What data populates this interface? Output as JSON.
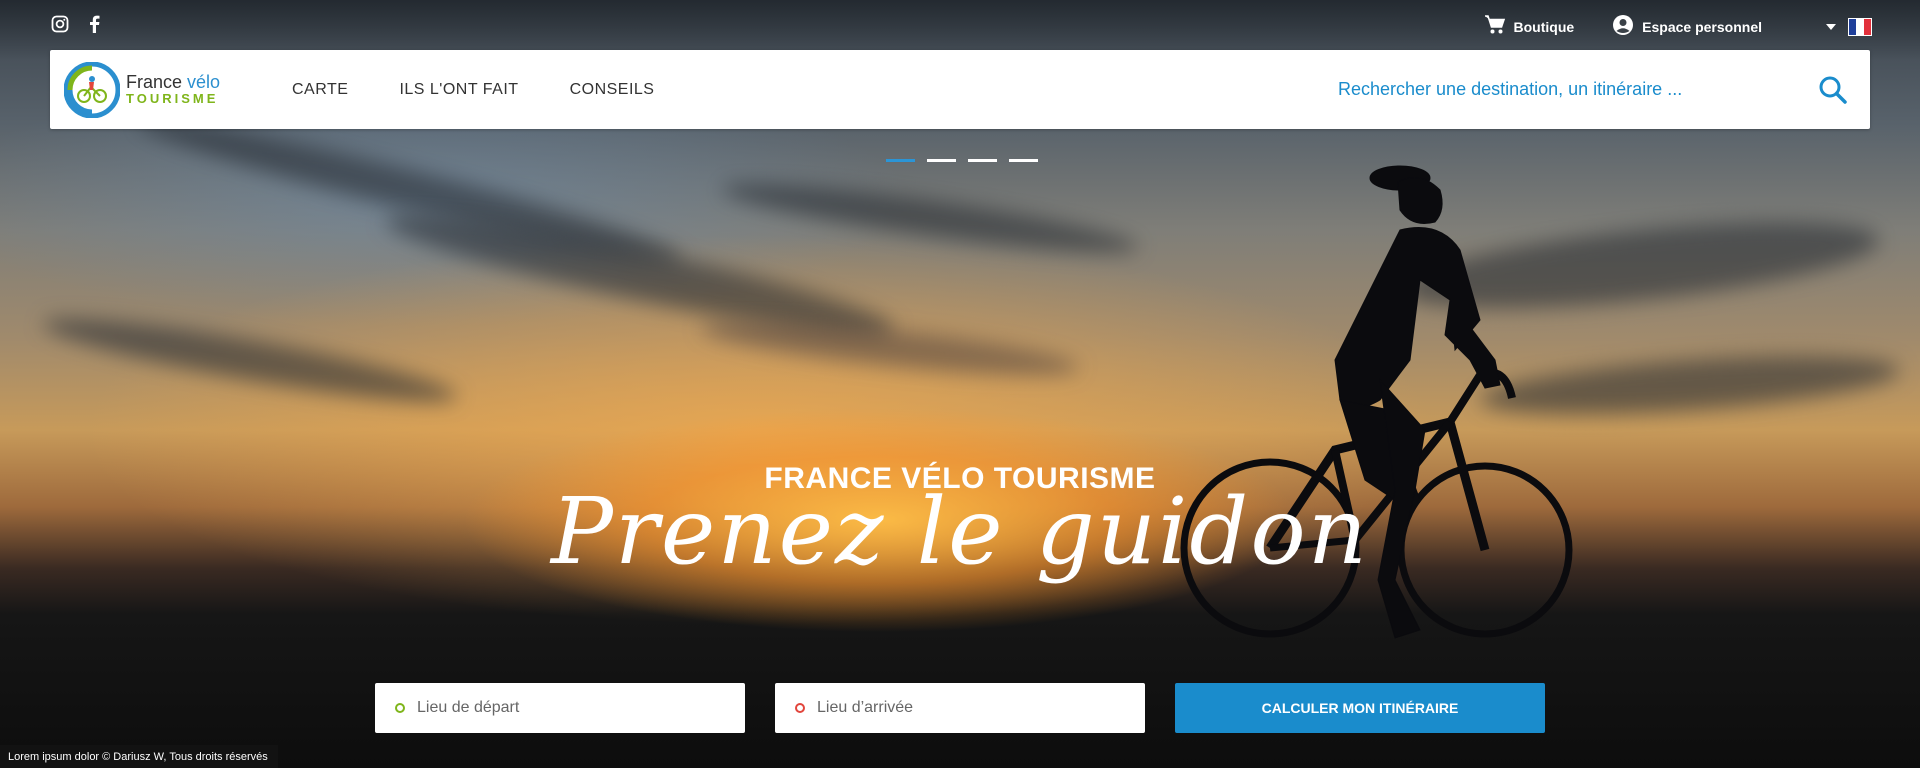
{
  "social": {
    "icons": [
      "instagram-icon",
      "facebook-icon"
    ]
  },
  "utility": {
    "shop_label": "Boutique",
    "account_label": "Espace personnel",
    "language": "fr"
  },
  "brand": {
    "line1_a": "France",
    "line1_b": "vélo",
    "line2": "TOURISME"
  },
  "nav": {
    "items": [
      {
        "label": "CARTE"
      },
      {
        "label": "ILS L'ONT FAIT"
      },
      {
        "label": "CONSEILS"
      }
    ]
  },
  "search": {
    "placeholder": "Rechercher une destination, un itinéraire ..."
  },
  "slider": {
    "count": 4,
    "active": 0
  },
  "hero": {
    "kicker": "FRANCE VÉLO TOURISME",
    "headline": "Prenez le guidon"
  },
  "route_form": {
    "departure_placeholder": "Lieu de départ",
    "arrival_placeholder": "Lieu d’arrivée",
    "submit_label": "CALCULER MON ITINÉRAIRE"
  },
  "credit": "Lorem ipsum dolor © Dariusz W, Tous droits réservés",
  "colors": {
    "accent": "#1a8ccc",
    "brand_green": "#7fb51b",
    "departure_pin": "#7fb51b",
    "arrival_pin": "#e2453c"
  }
}
